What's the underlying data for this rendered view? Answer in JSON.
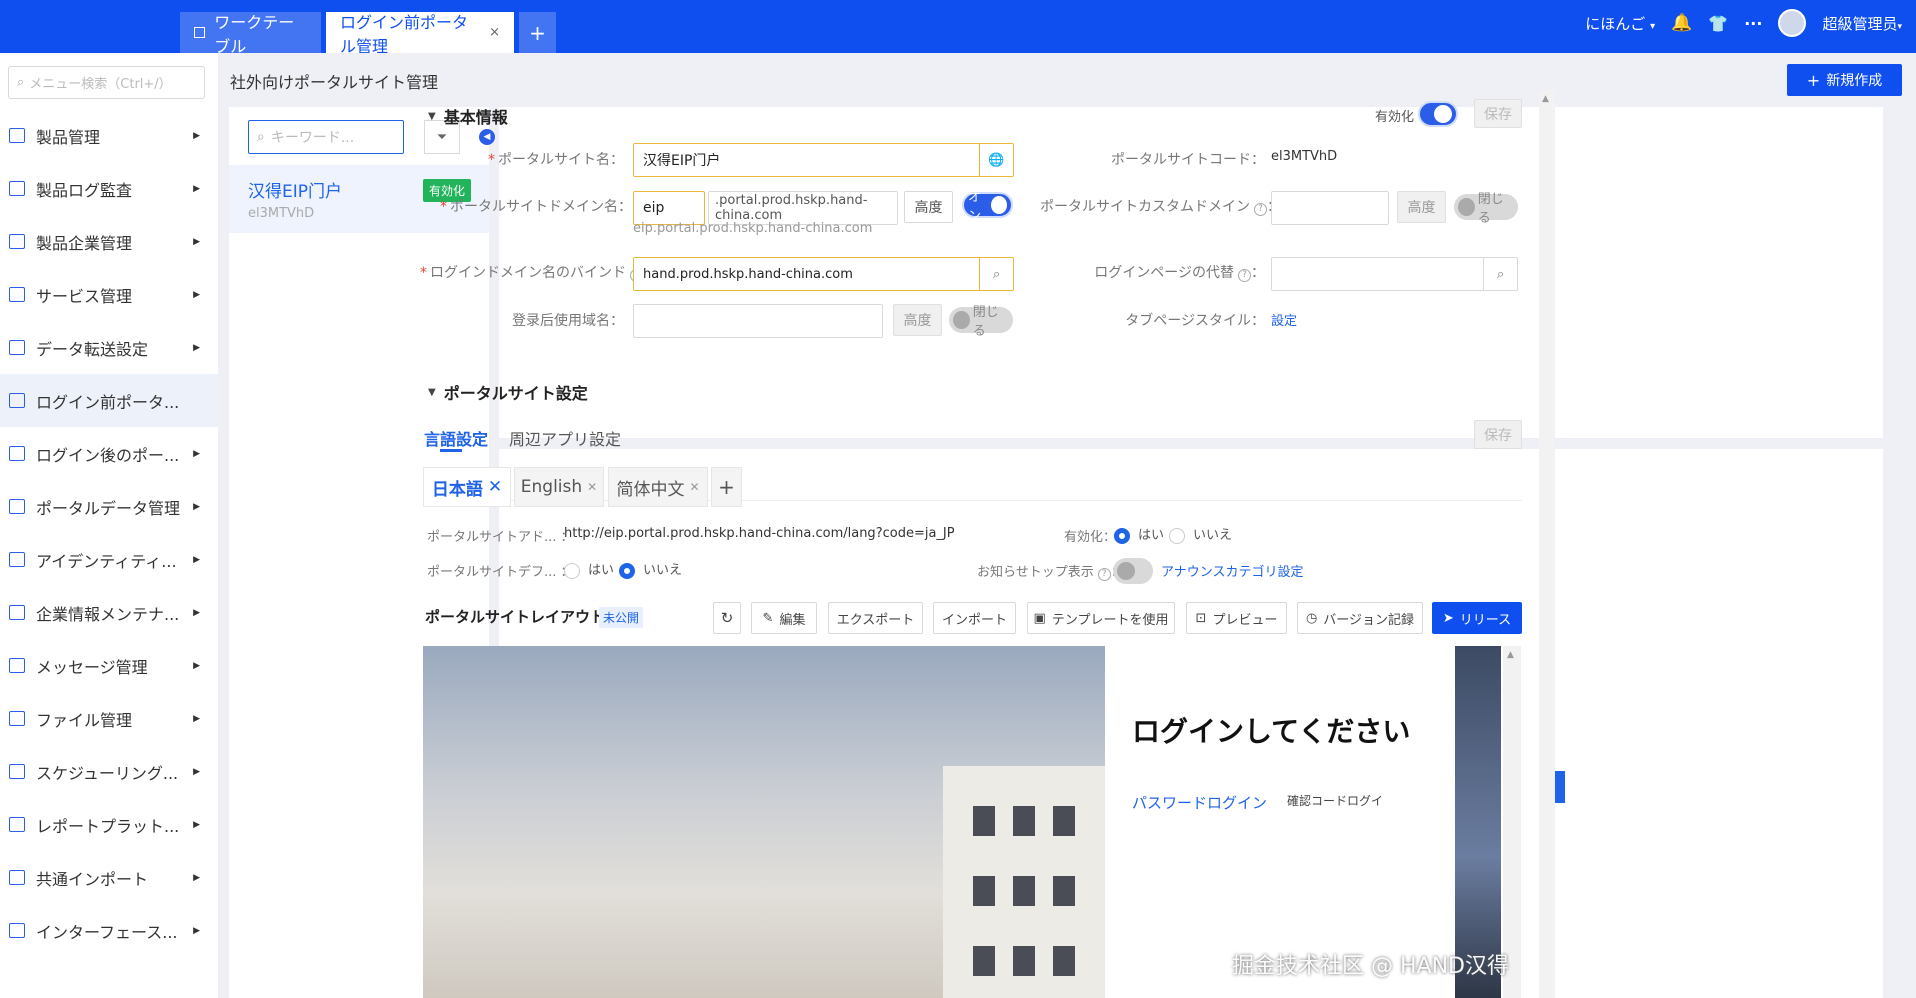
{
  "topbar": {
    "tab_workbench": "ワークテーブル",
    "tab_active": "ログイン前ポータル管理",
    "tab_close": "×",
    "tab_add": "+",
    "language": "にほんご",
    "user": "超級管理员"
  },
  "sidebar": {
    "search_placeholder": "メニュー検索（Ctrl+/）",
    "items": [
      {
        "label": "製品管理"
      },
      {
        "label": "製品ログ監査"
      },
      {
        "label": "製品企業管理"
      },
      {
        "label": "サービス管理"
      },
      {
        "label": "データ転送設定"
      },
      {
        "label": "ログイン前ポータ..."
      },
      {
        "label": "ログイン後のポー..."
      },
      {
        "label": "ポータルデータ管理"
      },
      {
        "label": "アイデンティティ..."
      },
      {
        "label": "企業情報メンテナ..."
      },
      {
        "label": "メッセージ管理"
      },
      {
        "label": "ファイル管理"
      },
      {
        "label": "スケジューリング..."
      },
      {
        "label": "レポートプラット..."
      },
      {
        "label": "共通インポート"
      },
      {
        "label": "インターフェース..."
      }
    ]
  },
  "header": {
    "breadcrumb": "社外向けポータルサイト管理",
    "new_button": "新規作成"
  },
  "list": {
    "search_placeholder": "キーワード...",
    "item": {
      "name": "汉得EIP门户",
      "code": "el3MTVhD",
      "badge": "有効化"
    }
  },
  "basic": {
    "title": "基本情報",
    "enable_label": "有効化",
    "save": "保存",
    "site_name_label": "ポータルサイト名：",
    "site_name": "汉得EIP门户",
    "site_code_label": "ポータルサイトコード：",
    "site_code": "el3MTVhD",
    "domain_label": "ポータルサイトドメイン名：",
    "domain_prefix": "eip",
    "domain_suffix": ".portal.prod.hskp.hand-china.com",
    "domain_hint": "eip.portal.prod.hskp.hand-china.com",
    "advanced": "高度",
    "on": "オン",
    "off": "閉じる",
    "custom_domain_label": "ポータルサイトカスタムドメイン",
    "login_domain_label": "ログインドメイン名のバインド",
    "login_domain": "hand.prod.hskp.hand-china.com",
    "login_replace_label": "ログインページの代替",
    "after_login_label": "登录后使用域名：",
    "tab_style_label": "タブページスタイル：",
    "tab_style_link": "設定"
  },
  "settings": {
    "title": "ポータルサイト設定",
    "tab_lang": "言語設定",
    "tab_apps": "周辺アプリ設定",
    "save": "保存",
    "langs": [
      "日本語",
      "English",
      "简体中文"
    ],
    "url_label": "ポータルサイトアド...",
    "url": "http://eip.portal.prod.hskp.hand-china.com/lang?code=ja_JP",
    "enable_label": "有効化：",
    "yes": "はい",
    "no": "いいえ",
    "default_label": "ポータルサイトデフ...",
    "notice_label": "お知らせトップ表示",
    "notice_link": "アナウンスカテゴリ設定"
  },
  "layout": {
    "title": "ポータルサイトレイアウト",
    "status": "未公開",
    "edit": "編集",
    "export": "エクスポート",
    "import": "インポート",
    "template": "テンプレートを使用",
    "preview": "プレビュー",
    "versions": "バージョン記録",
    "release": "リリース",
    "login_title": "ログインしてください",
    "pw_login": "パスワードログイン",
    "code_login": "確認コードログイ"
  },
  "watermark": "掘金技术社区 @ HAND汉得",
  "colors": {
    "primary": "#0f4ff0",
    "success": "#21b45a"
  }
}
